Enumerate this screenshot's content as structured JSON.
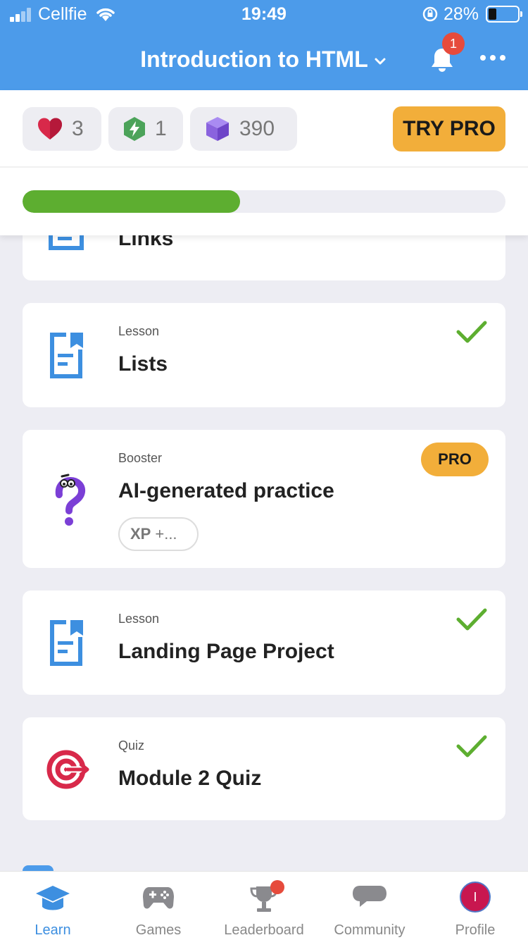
{
  "status_bar": {
    "carrier": "Cellfie",
    "time": "19:49",
    "battery_percent": "28%",
    "battery_level": 0.28,
    "icons": [
      "signal-icon",
      "wifi-icon",
      "rotation-lock-icon",
      "battery-icon"
    ]
  },
  "header": {
    "title": "Introduction to HTML",
    "notification_count": "1",
    "icons": [
      "chevron-down-icon",
      "bell-icon",
      "more-icon"
    ]
  },
  "stats": {
    "hearts": "3",
    "streak": "1",
    "xp": "390",
    "try_pro_label": "TRY PRO",
    "colors": {
      "heart": "#D8294A",
      "streak": "#4CA35A",
      "xp": "#8A63DE",
      "pro": "#F2AE3A"
    }
  },
  "progress": {
    "fraction": 0.45,
    "color": "#5DAE30"
  },
  "lessons": [
    {
      "kind": "",
      "title": "Links",
      "icon": "lesson-icon"
    },
    {
      "kind": "Lesson",
      "title": "Lists",
      "icon": "lesson-icon",
      "completed": true
    },
    {
      "kind": "Booster",
      "title": "AI-generated practice",
      "icon": "question-mark-icon",
      "badge": "PRO",
      "xp_label": "XP",
      "xp_value": "+..."
    },
    {
      "kind": "Lesson",
      "title": "Landing Page Project",
      "icon": "lesson-icon",
      "completed": true
    },
    {
      "kind": "Quiz",
      "title": "Module 2 Quiz",
      "icon": "target-icon",
      "completed": true
    }
  ],
  "tabbar": {
    "tabs": [
      {
        "label": "Learn",
        "icon": "graduation-cap-icon",
        "active": true
      },
      {
        "label": "Games",
        "icon": "gamepad-icon"
      },
      {
        "label": "Leaderboard",
        "icon": "trophy-icon"
      },
      {
        "label": "Community",
        "icon": "chat-bubble-icon"
      },
      {
        "label": "Profile",
        "icon": "avatar"
      }
    ],
    "profile_initial": "I"
  }
}
